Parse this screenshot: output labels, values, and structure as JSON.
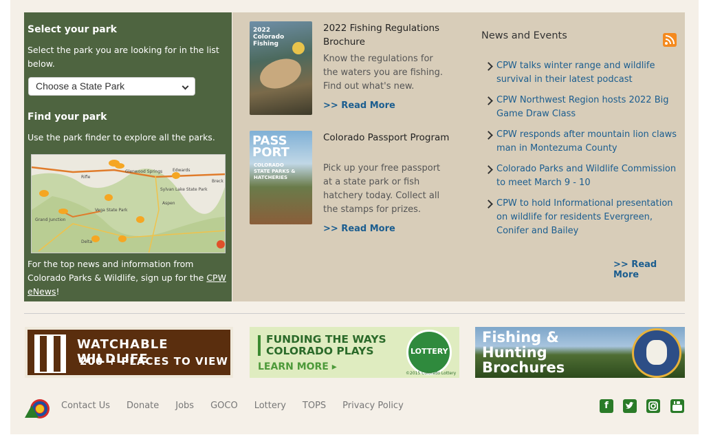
{
  "left": {
    "select_heading": "Select your park",
    "select_text": "Select the park you are looking for in the list below.",
    "select_value": "Choose a State Park",
    "find_heading": "Find your park",
    "find_text": "Use the park finder to explore all the parks.",
    "news_text_pre": "For the top news and information from Colorado Parks & Wildlife, sign up for the ",
    "news_link": "CPW eNews",
    "news_text_post": "!"
  },
  "map": {
    "labels": [
      "Rifle",
      "Glenwood Springs",
      "Edwards",
      "Breck",
      "Vega State Park",
      "Sylvan Lake State Park",
      "Aspen",
      "Grand Junction",
      "Delta"
    ]
  },
  "cards": [
    {
      "title": "2022 Fishing Regulations Brochure",
      "description": "Know the regulations for the waters you are fishing. Find out what's new.",
      "read_more": ">> Read More",
      "cover_text": "2022 Colorado Fishing"
    },
    {
      "title": "Colorado Passport Program",
      "description": "Pick up your free passport at a state park or fish hatchery today. Collect all the stamps for prizes.",
      "read_more": ">> Read More",
      "cover_text_1": "PASS",
      "cover_text_2": "PORT",
      "cover_text_3": "COLORADO STATE PARKS & HATCHERIES"
    }
  ],
  "news": {
    "heading": "News and Events",
    "items": [
      "CPW talks winter range and wildlife survival in their latest podcast",
      "CPW Northwest Region hosts 2022 Big Game Draw Class",
      "CPW responds after mountain lion claws man in Montezuma County",
      "Colorado Parks and Wildlife Commission to meet March 9 - 10",
      "CPW to hold Informational presentation on wildlife for residents Evergreen, Conifer and Bailey"
    ],
    "read_more": ">> Read More"
  },
  "banners": {
    "wildlife_line1": "WATCHABLE WILDLIFE",
    "wildlife_line2": "200 + PLACES TO VIEW",
    "lottery_line1": "FUNDING THE WAYS",
    "lottery_line2": "COLORADO PLAYS",
    "lottery_cta": "LEARN MORE",
    "lottery_badge": "LOTTERY",
    "lottery_copy": "©2015 Colorado Lottery",
    "fishing_line1": "Fishing &",
    "fishing_line2": "Hunting",
    "fishing_line3": "Brochures"
  },
  "footer": {
    "links": [
      "Contact Us",
      "Donate",
      "Jobs",
      "GOCO",
      "Lottery",
      "TOPS",
      "Privacy Policy"
    ],
    "social": [
      "facebook-icon",
      "twitter-icon",
      "instagram-icon",
      "youtube-icon"
    ]
  },
  "colors": {
    "panel_green": "#4e6440",
    "panel_tan": "#d8cdb9",
    "link_blue": "#1b5d8f",
    "social_green": "#2a7b28"
  }
}
